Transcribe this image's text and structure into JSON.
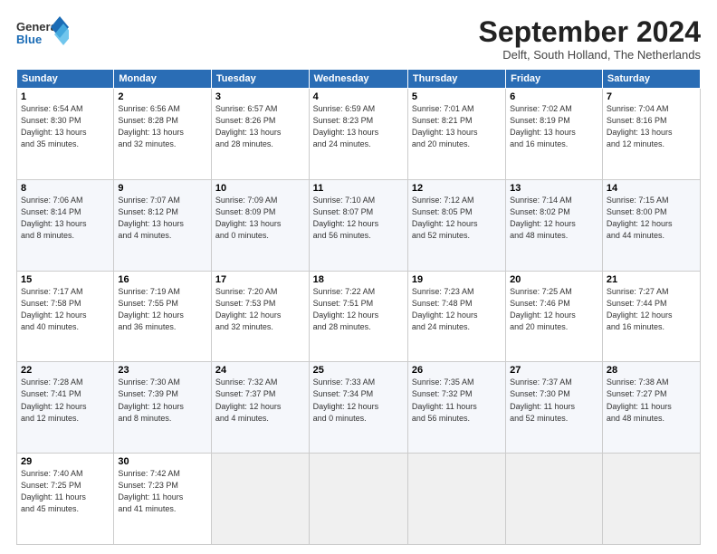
{
  "logo": {
    "line1": "General",
    "line2": "Blue"
  },
  "title": "September 2024",
  "subtitle": "Delft, South Holland, The Netherlands",
  "weekdays": [
    "Sunday",
    "Monday",
    "Tuesday",
    "Wednesday",
    "Thursday",
    "Friday",
    "Saturday"
  ],
  "weeks": [
    [
      {
        "day": "1",
        "info": "Sunrise: 6:54 AM\nSunset: 8:30 PM\nDaylight: 13 hours\nand 35 minutes."
      },
      {
        "day": "2",
        "info": "Sunrise: 6:56 AM\nSunset: 8:28 PM\nDaylight: 13 hours\nand 32 minutes."
      },
      {
        "day": "3",
        "info": "Sunrise: 6:57 AM\nSunset: 8:26 PM\nDaylight: 13 hours\nand 28 minutes."
      },
      {
        "day": "4",
        "info": "Sunrise: 6:59 AM\nSunset: 8:23 PM\nDaylight: 13 hours\nand 24 minutes."
      },
      {
        "day": "5",
        "info": "Sunrise: 7:01 AM\nSunset: 8:21 PM\nDaylight: 13 hours\nand 20 minutes."
      },
      {
        "day": "6",
        "info": "Sunrise: 7:02 AM\nSunset: 8:19 PM\nDaylight: 13 hours\nand 16 minutes."
      },
      {
        "day": "7",
        "info": "Sunrise: 7:04 AM\nSunset: 8:16 PM\nDaylight: 13 hours\nand 12 minutes."
      }
    ],
    [
      {
        "day": "8",
        "info": "Sunrise: 7:06 AM\nSunset: 8:14 PM\nDaylight: 13 hours\nand 8 minutes."
      },
      {
        "day": "9",
        "info": "Sunrise: 7:07 AM\nSunset: 8:12 PM\nDaylight: 13 hours\nand 4 minutes."
      },
      {
        "day": "10",
        "info": "Sunrise: 7:09 AM\nSunset: 8:09 PM\nDaylight: 13 hours\nand 0 minutes."
      },
      {
        "day": "11",
        "info": "Sunrise: 7:10 AM\nSunset: 8:07 PM\nDaylight: 12 hours\nand 56 minutes."
      },
      {
        "day": "12",
        "info": "Sunrise: 7:12 AM\nSunset: 8:05 PM\nDaylight: 12 hours\nand 52 minutes."
      },
      {
        "day": "13",
        "info": "Sunrise: 7:14 AM\nSunset: 8:02 PM\nDaylight: 12 hours\nand 48 minutes."
      },
      {
        "day": "14",
        "info": "Sunrise: 7:15 AM\nSunset: 8:00 PM\nDaylight: 12 hours\nand 44 minutes."
      }
    ],
    [
      {
        "day": "15",
        "info": "Sunrise: 7:17 AM\nSunset: 7:58 PM\nDaylight: 12 hours\nand 40 minutes."
      },
      {
        "day": "16",
        "info": "Sunrise: 7:19 AM\nSunset: 7:55 PM\nDaylight: 12 hours\nand 36 minutes."
      },
      {
        "day": "17",
        "info": "Sunrise: 7:20 AM\nSunset: 7:53 PM\nDaylight: 12 hours\nand 32 minutes."
      },
      {
        "day": "18",
        "info": "Sunrise: 7:22 AM\nSunset: 7:51 PM\nDaylight: 12 hours\nand 28 minutes."
      },
      {
        "day": "19",
        "info": "Sunrise: 7:23 AM\nSunset: 7:48 PM\nDaylight: 12 hours\nand 24 minutes."
      },
      {
        "day": "20",
        "info": "Sunrise: 7:25 AM\nSunset: 7:46 PM\nDaylight: 12 hours\nand 20 minutes."
      },
      {
        "day": "21",
        "info": "Sunrise: 7:27 AM\nSunset: 7:44 PM\nDaylight: 12 hours\nand 16 minutes."
      }
    ],
    [
      {
        "day": "22",
        "info": "Sunrise: 7:28 AM\nSunset: 7:41 PM\nDaylight: 12 hours\nand 12 minutes."
      },
      {
        "day": "23",
        "info": "Sunrise: 7:30 AM\nSunset: 7:39 PM\nDaylight: 12 hours\nand 8 minutes."
      },
      {
        "day": "24",
        "info": "Sunrise: 7:32 AM\nSunset: 7:37 PM\nDaylight: 12 hours\nand 4 minutes."
      },
      {
        "day": "25",
        "info": "Sunrise: 7:33 AM\nSunset: 7:34 PM\nDaylight: 12 hours\nand 0 minutes."
      },
      {
        "day": "26",
        "info": "Sunrise: 7:35 AM\nSunset: 7:32 PM\nDaylight: 11 hours\nand 56 minutes."
      },
      {
        "day": "27",
        "info": "Sunrise: 7:37 AM\nSunset: 7:30 PM\nDaylight: 11 hours\nand 52 minutes."
      },
      {
        "day": "28",
        "info": "Sunrise: 7:38 AM\nSunset: 7:27 PM\nDaylight: 11 hours\nand 48 minutes."
      }
    ],
    [
      {
        "day": "29",
        "info": "Sunrise: 7:40 AM\nSunset: 7:25 PM\nDaylight: 11 hours\nand 45 minutes."
      },
      {
        "day": "30",
        "info": "Sunrise: 7:42 AM\nSunset: 7:23 PM\nDaylight: 11 hours\nand 41 minutes."
      },
      {
        "day": "",
        "info": ""
      },
      {
        "day": "",
        "info": ""
      },
      {
        "day": "",
        "info": ""
      },
      {
        "day": "",
        "info": ""
      },
      {
        "day": "",
        "info": ""
      }
    ]
  ]
}
